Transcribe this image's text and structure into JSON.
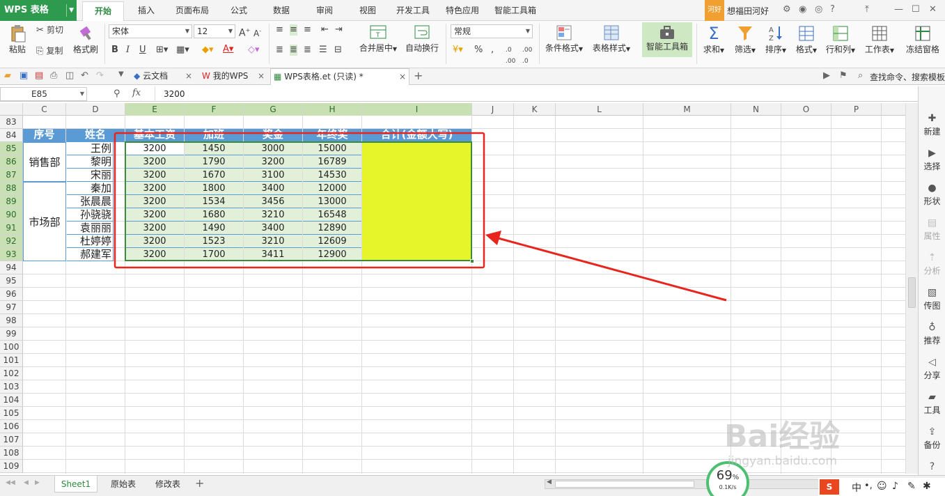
{
  "app": {
    "logo": "WPS 表格",
    "badge": "河好",
    "user": "想福田河好"
  },
  "menu": [
    "开始",
    "插入",
    "页面布局",
    "公式",
    "数据",
    "审阅",
    "视图",
    "开发工具",
    "特色应用",
    "智能工具箱"
  ],
  "ribbon": {
    "paste": "粘贴",
    "cut": "剪切",
    "copy": "复制",
    "format_painter": "格式刷",
    "font": "宋体",
    "font_size": "12",
    "merge_center": "合并居中",
    "wrap": "自动换行",
    "number_format": "常规",
    "conditional": "条件格式",
    "table_style": "表格样式",
    "smart_toolbox": "智能工具箱",
    "sum": "求和",
    "filter": "筛选",
    "sort": "排序",
    "format": "格式",
    "rows_cols": "行和列",
    "worksheet": "工作表",
    "freeze": "冻结窗格"
  },
  "doctabs": {
    "cloud": "云文档",
    "mywps": "我的WPS",
    "current": "WPS表格.et (只读) *",
    "search": "查找命令、搜索模板"
  },
  "formula": {
    "cell_ref": "E85",
    "fx": "fx",
    "value": "3200"
  },
  "columns": [
    "C",
    "D",
    "E",
    "F",
    "G",
    "H",
    "I",
    "J",
    "K",
    "L",
    "M",
    "N",
    "O",
    "P"
  ],
  "rows": [
    "83",
    "84",
    "85",
    "86",
    "87",
    "88",
    "89",
    "90",
    "91",
    "92",
    "93",
    "94",
    "95",
    "96",
    "97",
    "98",
    "99",
    "100",
    "101",
    "102",
    "103",
    "104",
    "105",
    "106",
    "107",
    "108",
    "109"
  ],
  "table": {
    "headers": [
      "序号",
      "姓名",
      "基本工资",
      "加班",
      "奖金",
      "年终奖",
      "合计(金额大写)"
    ],
    "depts": [
      "销售部",
      "市场部"
    ],
    "data": [
      [
        "王例",
        "3200",
        "1450",
        "3000",
        "15000"
      ],
      [
        "黎明",
        "3200",
        "1790",
        "3200",
        "16789"
      ],
      [
        "宋丽",
        "3200",
        "1670",
        "3100",
        "14530"
      ],
      [
        "秦加",
        "3200",
        "1800",
        "3400",
        "12000"
      ],
      [
        "张晨晨",
        "3200",
        "1534",
        "3456",
        "13000"
      ],
      [
        "孙骁骁",
        "3200",
        "1680",
        "3210",
        "16548"
      ],
      [
        "袁丽丽",
        "3200",
        "1490",
        "3400",
        "12890"
      ],
      [
        "杜婷婷",
        "3200",
        "1523",
        "3210",
        "12609"
      ],
      [
        "郝建军",
        "3200",
        "1700",
        "3411",
        "12900"
      ]
    ]
  },
  "sidebar": [
    "新建",
    "选择",
    "形状",
    "属性",
    "分析",
    "传图",
    "推荐",
    "分享",
    "工具",
    "备份",
    "帮助"
  ],
  "sheets": [
    "Sheet1",
    "原始表",
    "修改表"
  ],
  "status": {
    "net_pct": "69",
    "pct_sign": "%",
    "net_speed": "0.1K/s"
  },
  "watermark": {
    "brand": "Bai经验",
    "url": "jingyan.baidu.com"
  },
  "colors": {
    "accent": "#2e9a4e",
    "header_blue": "#5b9bd5",
    "data_green": "#e2f0d9",
    "total_yellow": "#e6f52a",
    "annot_red": "#e8251c"
  }
}
